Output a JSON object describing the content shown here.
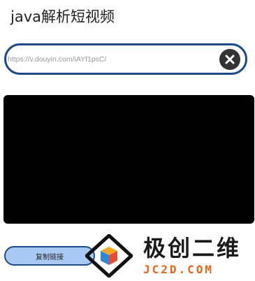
{
  "header": {
    "title": "java解析短视频"
  },
  "url_field": {
    "value": "https://v.douyin.com/iAYf1psC/",
    "clear_icon": "close-icon"
  },
  "video": {
    "state": "black"
  },
  "actions": {
    "copy_label": "复制链接"
  },
  "watermark": {
    "name_cn": "极创二维",
    "domain": "JC2D.COM"
  },
  "colors": {
    "accent": "#1f4a8a",
    "button_bg": "#a9c9f5",
    "watermark_orange": "#e8651a"
  }
}
